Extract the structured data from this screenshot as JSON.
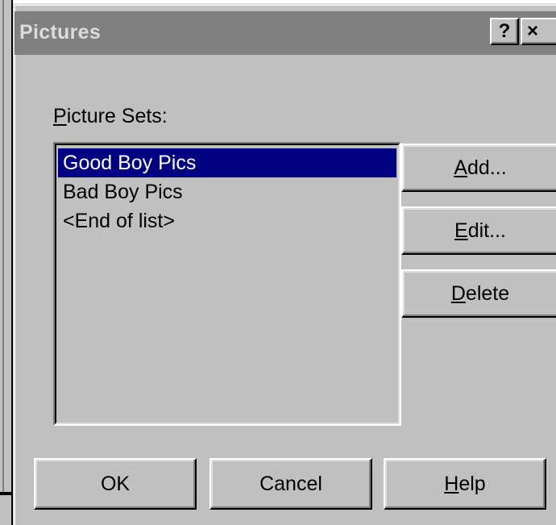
{
  "dialog": {
    "title": "Pictures",
    "help_glyph": "?",
    "close_glyph": "×"
  },
  "picture_sets": {
    "label_mnemonic": "P",
    "label_rest": "icture Sets:",
    "items": [
      {
        "label": "Good Boy Pics",
        "selected": true
      },
      {
        "label": "Bad Boy Pics",
        "selected": false
      },
      {
        "label": "<End of list>",
        "selected": false
      }
    ]
  },
  "side_buttons": {
    "add": {
      "mnemonic": "A",
      "rest": "dd..."
    },
    "edit": {
      "mnemonic": "E",
      "rest": "dit..."
    },
    "delete": {
      "mnemonic": "D",
      "rest": "elete"
    }
  },
  "footer_buttons": {
    "ok": "OK",
    "cancel": "Cancel",
    "help": {
      "mnemonic": "H",
      "rest": "elp"
    }
  },
  "colors": {
    "selection": "#000080",
    "face": "#c0c0c0",
    "titlebar_inactive": "#808080"
  }
}
